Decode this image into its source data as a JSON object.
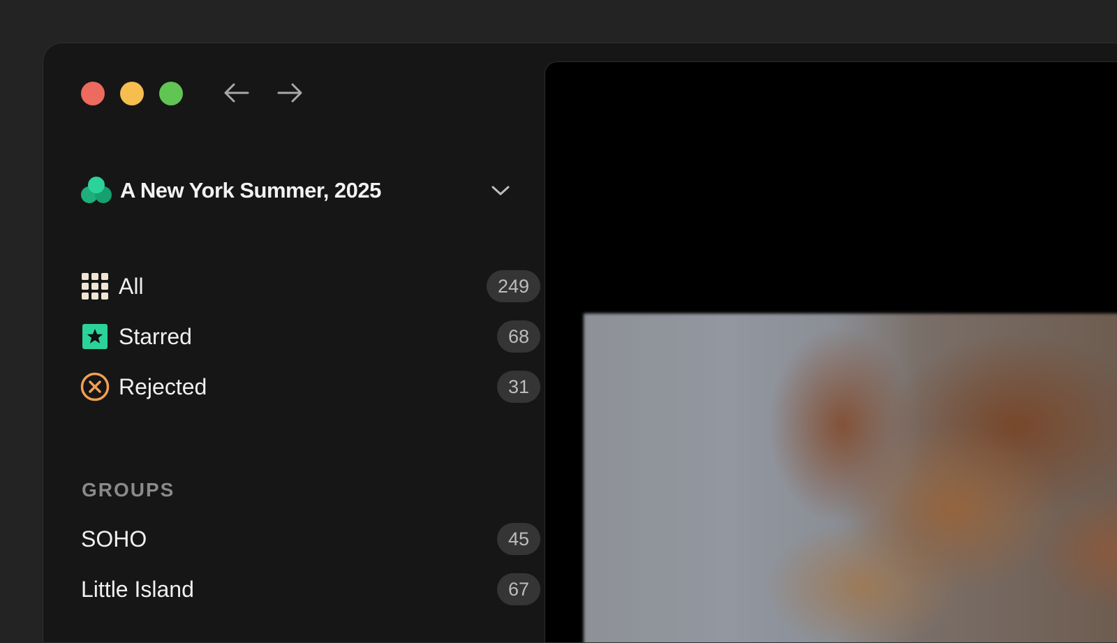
{
  "window": {
    "controls": {
      "close_color": "#ed6a5e",
      "minimize_color": "#f5be4f",
      "maximize_color": "#61c554"
    },
    "navigation": {
      "back_icon": "arrow-left-icon",
      "forward_icon": "arrow-right-icon"
    }
  },
  "sidebar": {
    "album": {
      "title": "A New York Summer, 2025",
      "logo_icon": "three-circles-logo",
      "logo_color": "#2bd39a",
      "dropdown_icon": "chevron-down-icon"
    },
    "filters": [
      {
        "label": "All",
        "count": "249",
        "icon": "grid-icon",
        "icon_color": "#efe6d2"
      },
      {
        "label": "Starred",
        "count": "68",
        "icon": "star-icon",
        "icon_color": "#2bd39a"
      },
      {
        "label": "Rejected",
        "count": "31",
        "icon": "x-circle-icon",
        "icon_color": "#f0a052"
      }
    ],
    "groups": {
      "header": "GROUPS",
      "items": [
        {
          "label": "SOHO",
          "count": "45"
        },
        {
          "label": "Little Island",
          "count": "67"
        }
      ]
    }
  },
  "main": {
    "background": "#000000",
    "photo": {
      "subject": "blurred-photo"
    }
  }
}
